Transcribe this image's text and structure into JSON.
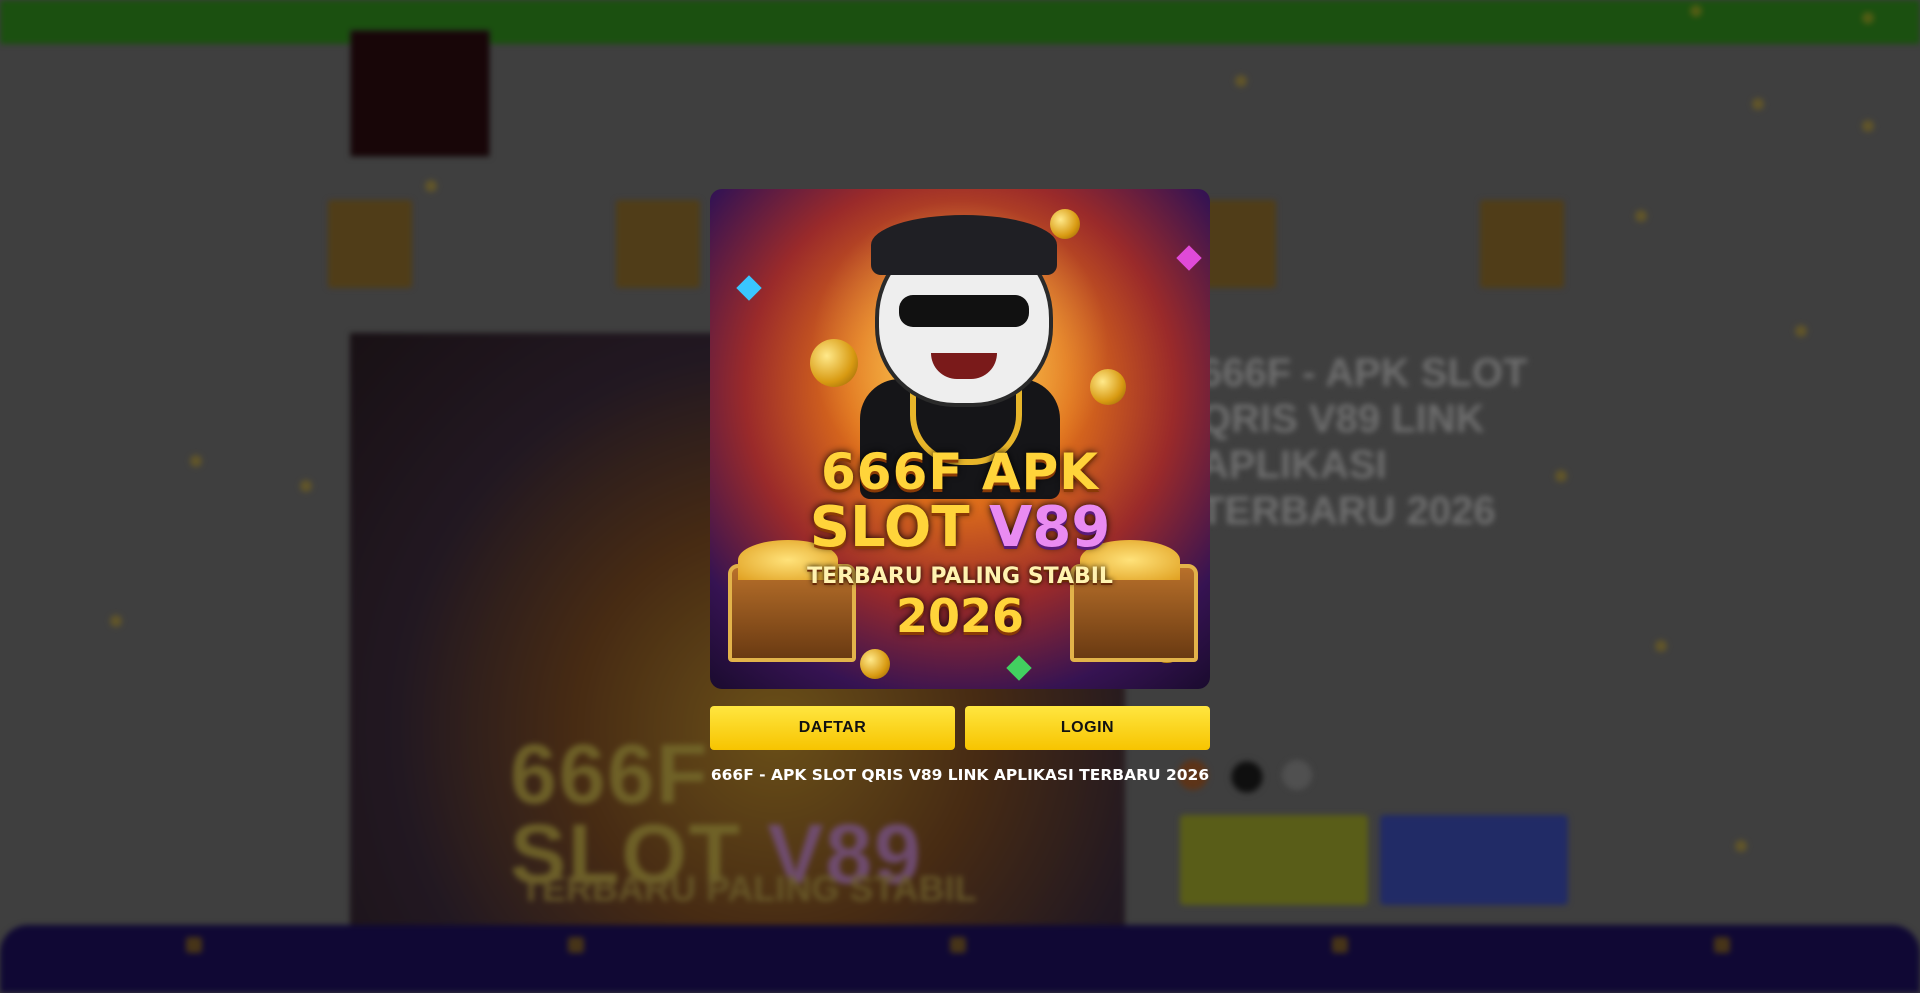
{
  "modal": {
    "poster": {
      "line1": "666F APK",
      "line2_left": "SLOT ",
      "line2_right": "V89",
      "line3": "TERBARU PALING STABIL",
      "line4": "2026"
    },
    "buttons": {
      "daftar": "DAFTAR",
      "login": "LOGIN"
    },
    "caption": "666F - APK SLOT QRIS V89 LINK APLIKASI TERBARU 2026"
  },
  "background": {
    "product_title": "666F - APK SLOT QRIS V89 LINK APLIKASI TERBARU 2026",
    "hero": {
      "line1": "666F",
      "line2_left": "SLOT ",
      "line2_right": "V89",
      "line3": "TERBARU PALING STABIL"
    }
  },
  "colors": {
    "button_yellow": "#ffd400",
    "bottom_nav": "#1c0f5a",
    "top_bar": "#2f8a1c"
  }
}
